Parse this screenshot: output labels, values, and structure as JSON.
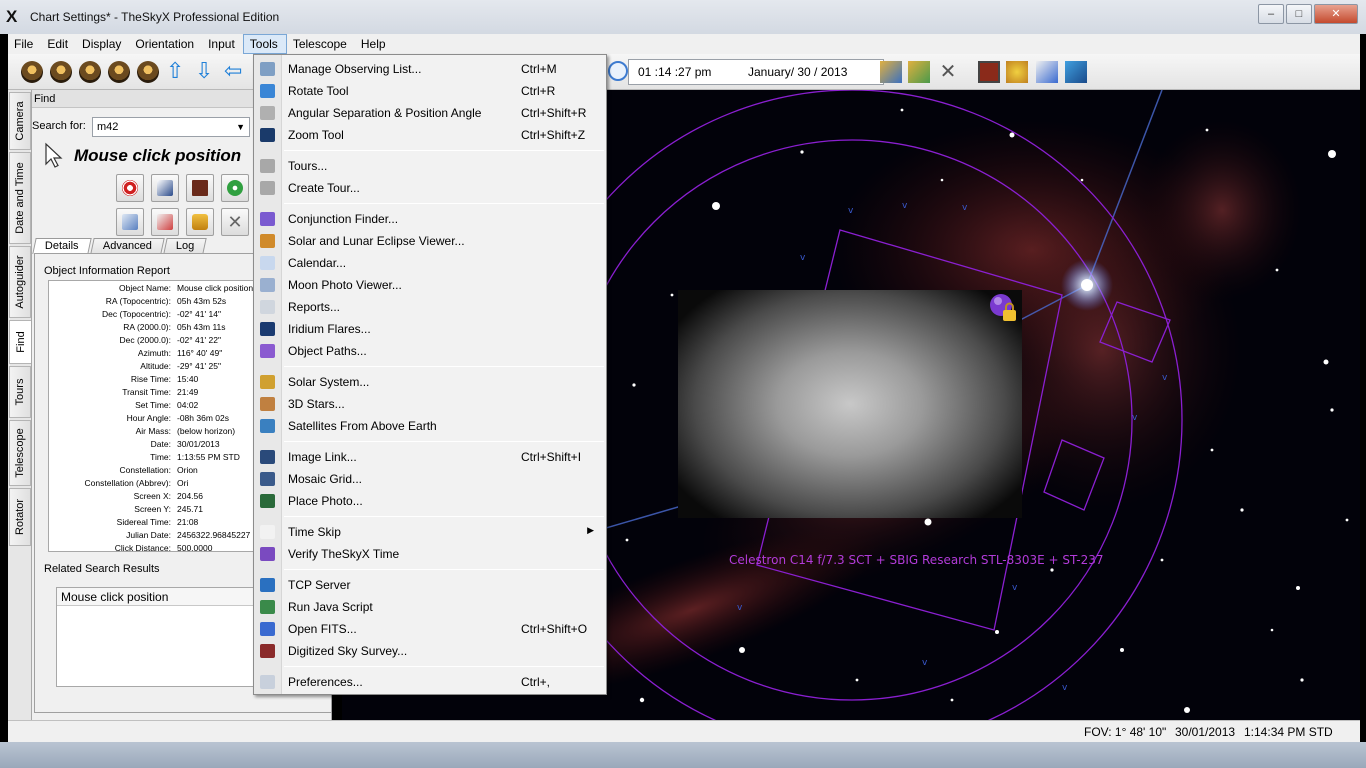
{
  "window": {
    "title": "Chart Settings* - TheSkyX Professional Edition",
    "logo_glyph": "X",
    "minimize_glyph": "–",
    "maximize_glyph": "□",
    "close_glyph": "✕"
  },
  "menubar": {
    "items": [
      "File",
      "Edit",
      "Display",
      "Orientation",
      "Input",
      "Tools",
      "Telescope",
      "Help"
    ],
    "active": "Tools"
  },
  "toolbar": {
    "time": "01 :14 :27  pm",
    "date": "January/ 30 / 2013",
    "arrow_up": "⇧",
    "arrow_down": "⇩",
    "arrow_left": "⇦"
  },
  "left_tabs": [
    "Camera",
    "Date and Time",
    "Autoguider",
    "Find",
    "Tours",
    "Telescope",
    "Rotator"
  ],
  "left_tabs_active": "Find",
  "find": {
    "header": "Find",
    "search_label": "Search for:",
    "search_value": "m42",
    "dropdown_glyph": "▼",
    "heading": "Mouse click position",
    "subtabs": [
      "Details",
      "Advanced",
      "Log"
    ],
    "subtab_active": "Details",
    "report_label": "Object Information Report",
    "report": [
      {
        "k": "Object Name:",
        "v": "Mouse click position"
      },
      {
        "k": "RA (Topocentric):",
        "v": "05h 43m 52s"
      },
      {
        "k": "Dec (Topocentric):",
        "v": "-02° 41' 14\""
      },
      {
        "k": "RA (2000.0):",
        "v": "05h 43m 11s"
      },
      {
        "k": "Dec (2000.0):",
        "v": "-02° 41' 22\""
      },
      {
        "k": "Azimuth:",
        "v": "116° 40' 49\""
      },
      {
        "k": "Altitude:",
        "v": "-29° 41' 25\""
      },
      {
        "k": "Rise Time:",
        "v": "15:40"
      },
      {
        "k": "Transit Time:",
        "v": "21:49"
      },
      {
        "k": "Set Time:",
        "v": "04:02"
      },
      {
        "k": "Hour Angle:",
        "v": "-08h 36m 02s"
      },
      {
        "k": "Air Mass:",
        "v": "(below horizon)"
      },
      {
        "k": "Date:",
        "v": "30/01/2013"
      },
      {
        "k": "Time:",
        "v": "1:13:55 PM STD"
      },
      {
        "k": "Constellation:",
        "v": "Orion"
      },
      {
        "k": "Constellation (Abbrev):",
        "v": "Ori"
      },
      {
        "k": "Screen X:",
        "v": "204.56"
      },
      {
        "k": "Screen Y:",
        "v": "245.71"
      },
      {
        "k": "Sidereal Time:",
        "v": "21:08"
      },
      {
        "k": "Julian Date:",
        "v": "2456322.96845227"
      },
      {
        "k": "Click Distance:",
        "v": "500.0000"
      }
    ],
    "related_label": "Related Search Results",
    "related_header": "Mouse click position"
  },
  "chart": {
    "fov_label": "Celestron C14 f/7.3 SCT + SBIG Research STL-8303E + ST-237"
  },
  "tools_menu": [
    {
      "label": "Manage Observing List...",
      "shortcut": "Ctrl+M",
      "icon": "list-icon",
      "color": "#7f9fc4"
    },
    {
      "label": "Rotate Tool",
      "shortcut": "Ctrl+R",
      "icon": "rotate-icon",
      "color": "#3a86d6"
    },
    {
      "label": "Angular Separation & Position Angle",
      "shortcut": "Ctrl+Shift+R",
      "icon": "ruler-icon",
      "color": "#b0b0b0"
    },
    {
      "label": "Zoom Tool",
      "shortcut": "Ctrl+Shift+Z",
      "icon": "zoom-icon",
      "color": "#1a3a6a"
    },
    {
      "sep": true
    },
    {
      "label": "Tours...",
      "shortcut": "",
      "icon": "tours-icon",
      "color": "#a8a8a8"
    },
    {
      "label": "Create Tour...",
      "shortcut": "",
      "icon": "create-tour-icon",
      "color": "#a8a8a8"
    },
    {
      "sep": true
    },
    {
      "label": "Conjunction Finder...",
      "shortcut": "",
      "icon": "conjunction-icon",
      "color": "#7a5ad0"
    },
    {
      "label": "Solar and Lunar Eclipse Viewer...",
      "shortcut": "",
      "icon": "eclipse-icon",
      "color": "#d08a2a"
    },
    {
      "label": "Calendar...",
      "shortcut": "",
      "icon": "calendar-icon",
      "color": "#c8d8ee"
    },
    {
      "label": "Moon Photo Viewer...",
      "shortcut": "",
      "icon": "moon-icon",
      "color": "#9ab0d0"
    },
    {
      "label": "Reports...",
      "shortcut": "",
      "icon": "reports-icon",
      "color": "#d0d6de"
    },
    {
      "label": "Iridium Flares...",
      "shortcut": "",
      "icon": "iridium-icon",
      "color": "#1a3a70"
    },
    {
      "label": "Object Paths...",
      "shortcut": "",
      "icon": "paths-icon",
      "color": "#8a5ad0"
    },
    {
      "sep": true
    },
    {
      "label": "Solar System...",
      "shortcut": "",
      "icon": "solar-system-icon",
      "color": "#d0a030"
    },
    {
      "label": "3D Stars...",
      "shortcut": "",
      "icon": "stars-3d-icon",
      "color": "#c08040"
    },
    {
      "label": "Satellites From Above Earth",
      "shortcut": "",
      "icon": "satellite-icon",
      "color": "#3a80c0"
    },
    {
      "sep": true
    },
    {
      "label": "Image Link...",
      "shortcut": "Ctrl+Shift+I",
      "icon": "image-link-icon",
      "color": "#2a4a7a"
    },
    {
      "label": "Mosaic Grid...",
      "shortcut": "",
      "icon": "mosaic-icon",
      "color": "#3a5a8a"
    },
    {
      "label": "Place Photo...",
      "shortcut": "",
      "icon": "place-photo-icon",
      "color": "#2a6a3a"
    },
    {
      "sep": true
    },
    {
      "label": "Time Skip",
      "shortcut": "",
      "icon": "time-skip-icon",
      "color": "#f2f2f2",
      "submenu": true
    },
    {
      "label": "Verify TheSkyX Time",
      "shortcut": "",
      "icon": "verify-time-icon",
      "color": "#7a4ac0"
    },
    {
      "sep": true
    },
    {
      "label": "TCP Server",
      "shortcut": "",
      "icon": "tcp-icon",
      "color": "#2a70c0"
    },
    {
      "label": "Run Java Script",
      "shortcut": "",
      "icon": "javascript-icon",
      "color": "#3a8a4a"
    },
    {
      "label": "Open FITS...",
      "shortcut": "Ctrl+Shift+O",
      "icon": "fits-icon",
      "color": "#3a6ad0"
    },
    {
      "label": "Digitized Sky Survey...",
      "shortcut": "",
      "icon": "dss-icon",
      "color": "#8a2a2a"
    },
    {
      "sep": true
    },
    {
      "label": "Preferences...",
      "shortcut": "Ctrl+,",
      "icon": "preferences-icon",
      "color": "#c8d0dc"
    }
  ],
  "tools_submenu_glyph": "▶",
  "status": {
    "fov": "FOV: 1° 48' 10\"",
    "date": "30/01/2013",
    "time": "1:14:34 PM STD"
  },
  "colors": {
    "fov_outline": "#8a1fd0",
    "menu_highlight": "#dbe9f8",
    "chart_bg": "#02020a"
  }
}
